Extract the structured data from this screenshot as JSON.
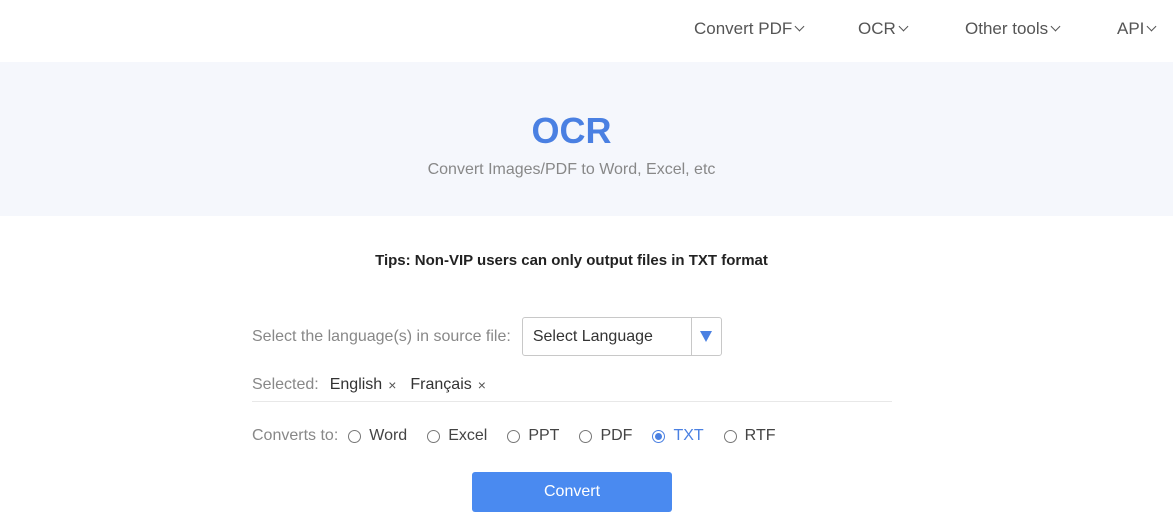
{
  "nav": {
    "items": [
      {
        "label": "Convert PDF"
      },
      {
        "label": "OCR"
      },
      {
        "label": "Other tools"
      },
      {
        "label": "API"
      }
    ]
  },
  "hero": {
    "title": "OCR",
    "subtitle": "Convert Images/PDF to Word, Excel, etc"
  },
  "main": {
    "tips": "Tips: Non-VIP users can only output files in TXT format",
    "language_label": "Select the language(s) in source file:",
    "language_select": {
      "value": "Select Language"
    },
    "selected_label": "Selected:",
    "selected_languages": [
      {
        "label": "English",
        "remove": "×"
      },
      {
        "label": "Français",
        "remove": "×"
      }
    ],
    "converts_label": "Converts to:",
    "formats": [
      {
        "label": "Word",
        "checked": false
      },
      {
        "label": "Excel",
        "checked": false
      },
      {
        "label": "PPT",
        "checked": false
      },
      {
        "label": "PDF",
        "checked": false
      },
      {
        "label": "TXT",
        "checked": true
      },
      {
        "label": "RTF",
        "checked": false
      }
    ],
    "convert_button": "Convert"
  },
  "colors": {
    "accent": "#4a80e2",
    "button": "#4a8af0",
    "hero_bg": "#f5f7fc"
  }
}
